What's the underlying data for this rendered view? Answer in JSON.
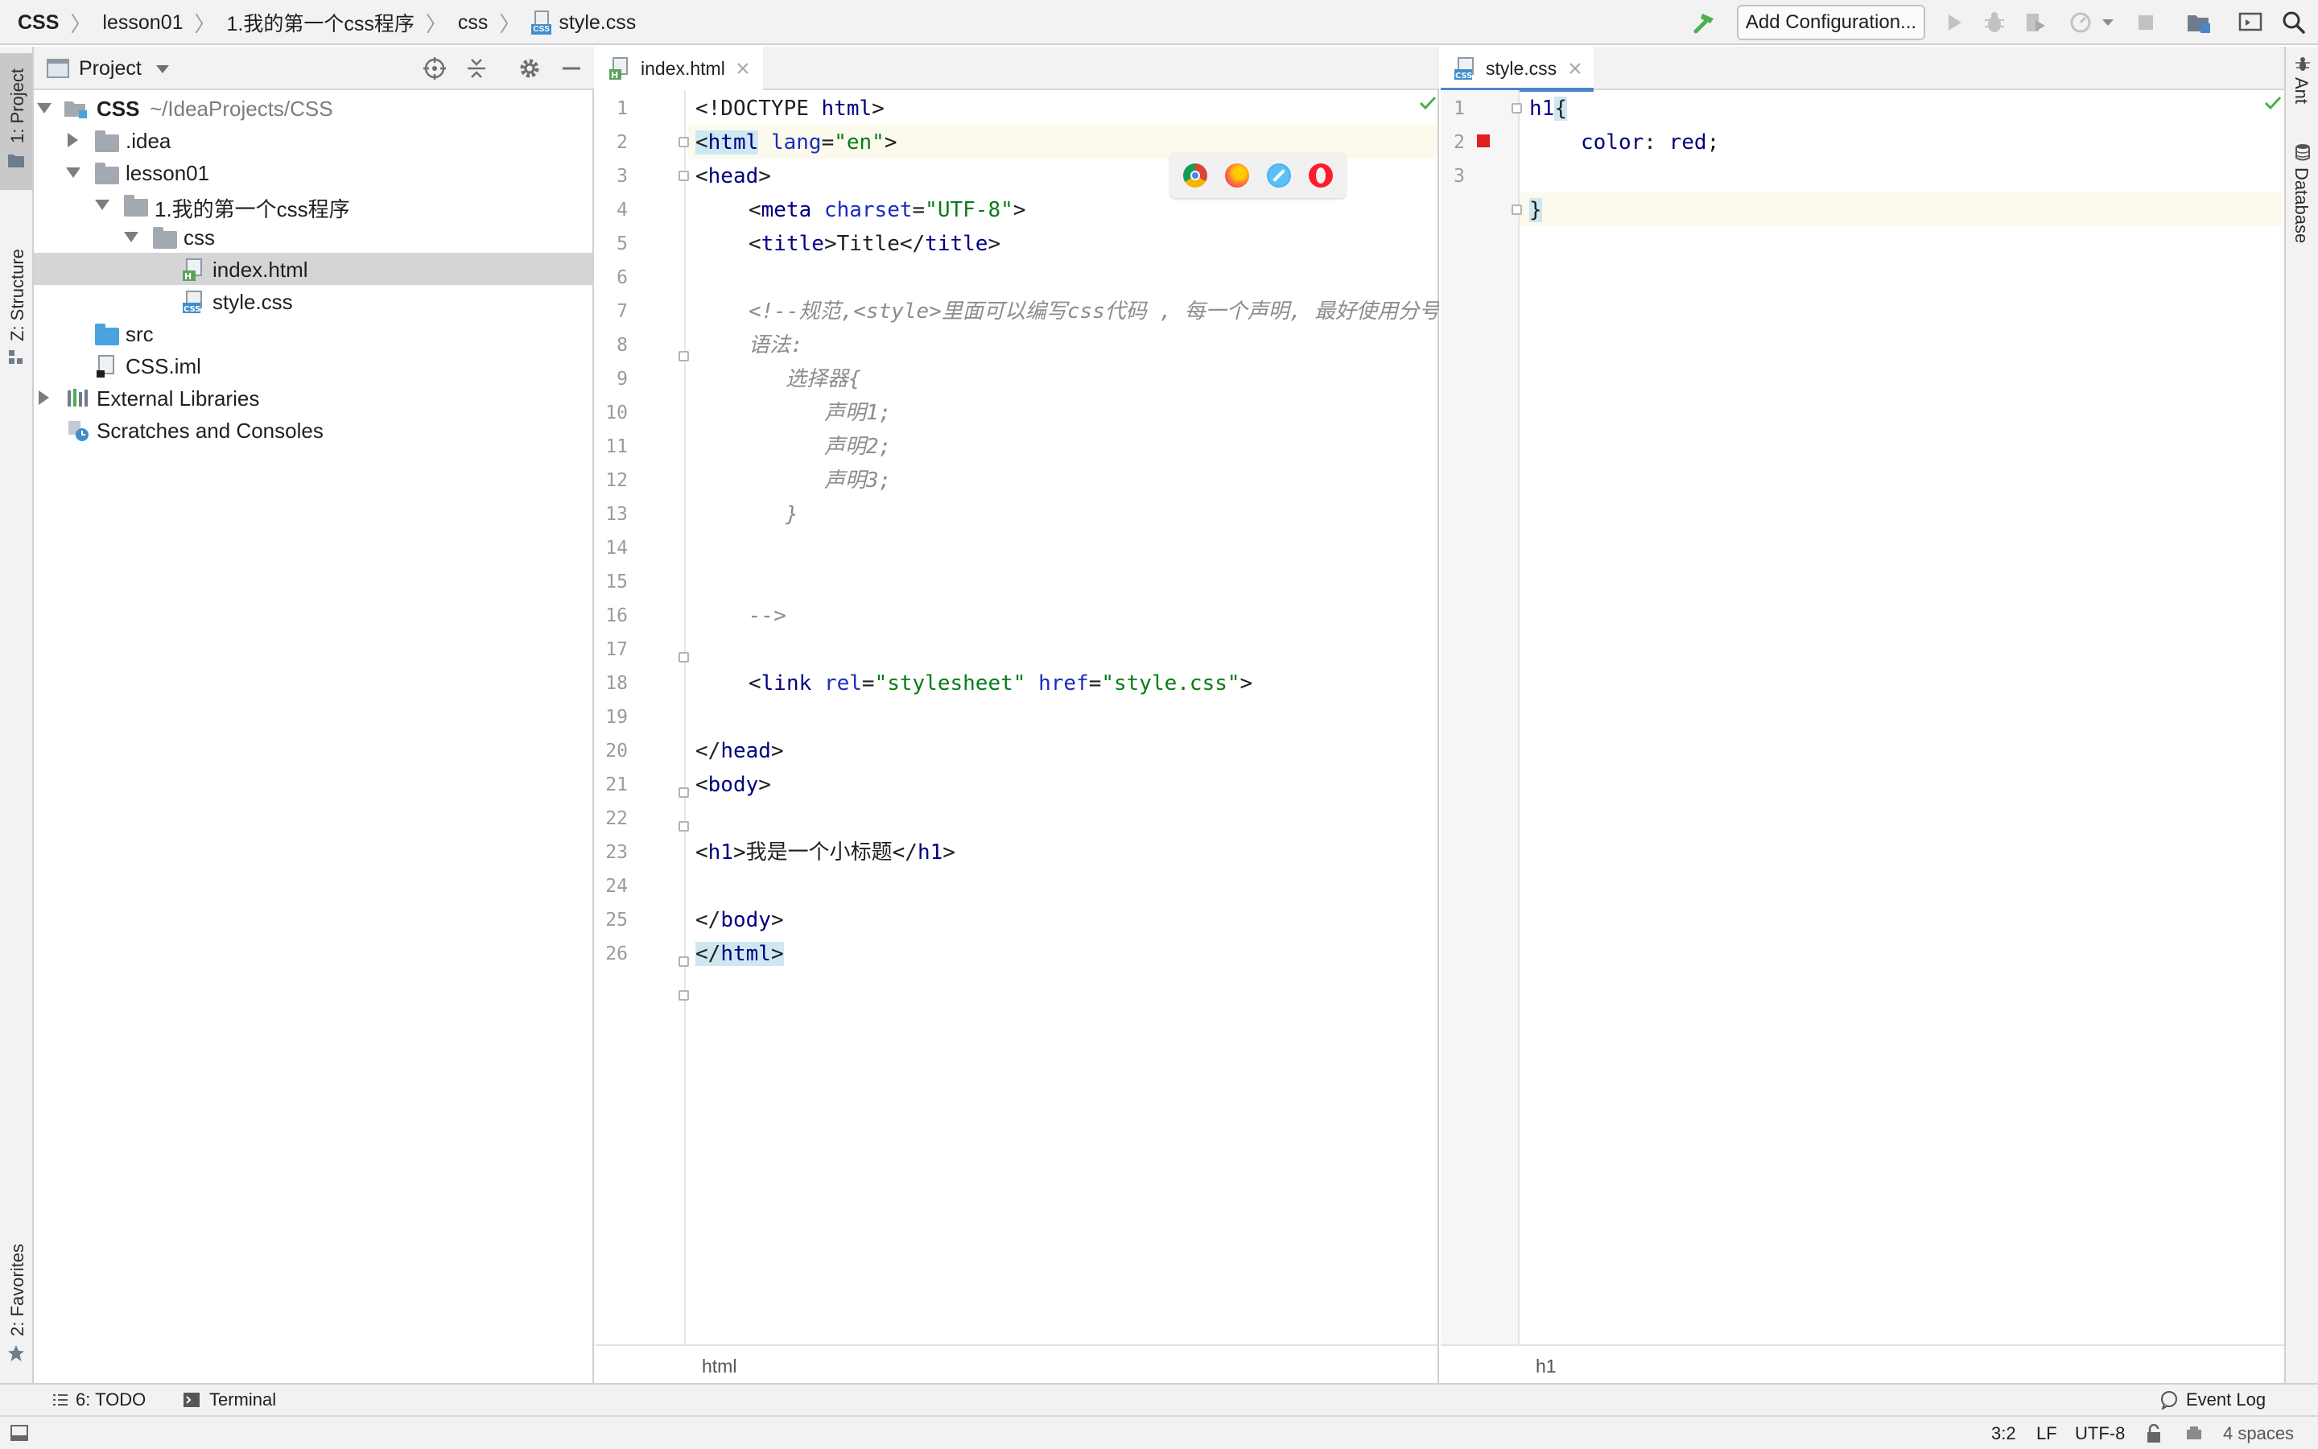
{
  "breadcrumb": {
    "items": [
      "CSS",
      "lesson01",
      "1.我的第一个css程序",
      "css",
      "style.css"
    ]
  },
  "toolbar": {
    "add_configuration": "Add Configuration...",
    "icons": [
      "build-hammer-icon",
      "run-icon",
      "debug-icon",
      "coverage-icon",
      "profile-icon",
      "dropdown-icon",
      "stop-icon",
      "project-structure-icon",
      "presentation-icon",
      "search-icon"
    ]
  },
  "left_strip": {
    "project_tab": "1: Project",
    "structure_tab": "Z: Structure",
    "favorites_tab": "2: Favorites"
  },
  "right_strip": {
    "ant_tab": "Ant",
    "database_tab": "Database"
  },
  "project_panel": {
    "title": "Project",
    "tree": [
      {
        "label": "CSS",
        "suffix": "~/IdeaProjects/CSS",
        "icon": "module-folder-icon",
        "expanded": true
      },
      {
        "label": ".idea",
        "icon": "folder-icon",
        "expanded": false
      },
      {
        "label": "lesson01",
        "icon": "folder-icon",
        "expanded": true
      },
      {
        "label": "1.我的第一个css程序",
        "icon": "folder-icon",
        "expanded": true
      },
      {
        "label": "css",
        "icon": "folder-icon",
        "expanded": true
      },
      {
        "label": "index.html",
        "icon": "html-file-icon",
        "selected": true
      },
      {
        "label": "style.css",
        "icon": "css-file-icon"
      },
      {
        "label": "src",
        "icon": "source-folder-icon"
      },
      {
        "label": "CSS.iml",
        "icon": "iml-file-icon"
      },
      {
        "label": "External Libraries",
        "icon": "libraries-icon",
        "expanded": false
      },
      {
        "label": "Scratches and Consoles",
        "icon": "scratches-icon"
      }
    ]
  },
  "editor_left": {
    "tab": "index.html",
    "footer": "html",
    "line_numbers": [
      "1",
      "2",
      "3",
      "4",
      "5",
      "6",
      "7",
      "8",
      "9",
      "10",
      "11",
      "12",
      "13",
      "14",
      "15",
      "16",
      "17",
      "18",
      "19",
      "20",
      "21",
      "22",
      "23",
      "24",
      "25",
      "26"
    ],
    "lines": {
      "l1_a": "<!DOCTYPE ",
      "l1_b": "html",
      "l1_c": ">",
      "l2_a": "<",
      "l2_b": "html",
      "l2_c": " ",
      "l2_d": "lang",
      "l2_e": "=",
      "l2_f": "\"en\"",
      "l2_g": ">",
      "l3_a": "<",
      "l3_b": "head",
      "l3_c": ">",
      "l4_a": "<",
      "l4_b": "meta",
      "l4_c": " ",
      "l4_d": "charset",
      "l4_e": "=",
      "l4_f": "\"UTF-8\"",
      "l4_g": ">",
      "l5_a": "<",
      "l5_b": "title",
      "l5_c": ">Title</",
      "l5_d": "title",
      "l5_e": ">",
      "l7": "<!--规范,<style>里面可以编写css代码 , 每一个声明, 最好使用分号结",
      "l8": "语法:",
      "l9": "选择器{",
      "l10": "声明1;",
      "l11": "声明2;",
      "l12": "声明3;",
      "l13": "}",
      "l16": "-->",
      "l18_a": "<",
      "l18_b": "link",
      "l18_c": " ",
      "l18_d": "rel",
      "l18_e": "=",
      "l18_f": "\"stylesheet\"",
      "l18_g": " ",
      "l18_h": "href",
      "l18_i": "=",
      "l18_j": "\"style.css\"",
      "l18_k": ">",
      "l20_a": "</",
      "l20_b": "head",
      "l20_c": ">",
      "l21_a": "<",
      "l21_b": "body",
      "l21_c": ">",
      "l23_a": "<",
      "l23_b": "h1",
      "l23_c": ">我是一个小标题</",
      "l23_d": "h1",
      "l23_e": ">",
      "l25_a": "</",
      "l25_b": "body",
      "l25_c": ">",
      "l26_a": "</",
      "l26_b": "html",
      "l26_c": ">"
    },
    "browsers": [
      "chrome-icon",
      "firefox-icon",
      "safari-icon",
      "opera-icon"
    ]
  },
  "editor_right": {
    "tab": "style.css",
    "footer": "h1",
    "line_numbers": [
      "1",
      "2",
      "3"
    ],
    "lines": {
      "l1_a": "h1",
      "l1_b": "{",
      "l2_a": "color",
      "l2_b": ": ",
      "l2_c": "red",
      "l2_d": ";",
      "l3": "}"
    },
    "color_swatch": "#e02020"
  },
  "tool_windows": {
    "todo": "6: TODO",
    "terminal": "Terminal",
    "event_log": "Event Log"
  },
  "status_bar": {
    "position": "3:2",
    "line_separator": "LF",
    "encoding": "UTF-8",
    "indent": "4 spaces"
  },
  "colors": {
    "accent": "#4a86c8",
    "check": "#4caf50",
    "tag": "#000080",
    "string": "#067d17",
    "attribute": "#1a2cbd",
    "comment": "#8c8c8c"
  }
}
